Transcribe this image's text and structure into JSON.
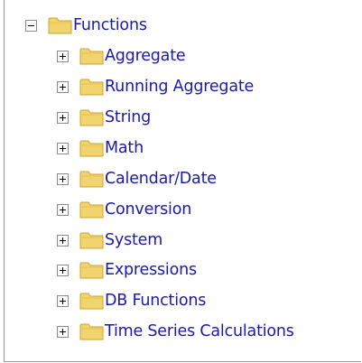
{
  "tree": {
    "root": {
      "label": "Functions",
      "expanded": true,
      "toggle_icon": "minus-box-icon",
      "icon": "folder-icon"
    },
    "children": [
      {
        "label": "Aggregate",
        "expanded": false,
        "toggle_icon": "plus-box-icon",
        "icon": "folder-icon"
      },
      {
        "label": "Running Aggregate",
        "expanded": false,
        "toggle_icon": "plus-box-icon",
        "icon": "folder-icon"
      },
      {
        "label": "String",
        "expanded": false,
        "toggle_icon": "plus-box-icon",
        "icon": "folder-icon"
      },
      {
        "label": "Math",
        "expanded": false,
        "toggle_icon": "plus-box-icon",
        "icon": "folder-icon"
      },
      {
        "label": "Calendar/Date",
        "expanded": false,
        "toggle_icon": "plus-box-icon",
        "icon": "folder-icon"
      },
      {
        "label": "Conversion",
        "expanded": false,
        "toggle_icon": "plus-box-icon",
        "icon": "folder-icon"
      },
      {
        "label": "System",
        "expanded": false,
        "toggle_icon": "plus-box-icon",
        "icon": "folder-icon"
      },
      {
        "label": "Expressions",
        "expanded": false,
        "toggle_icon": "plus-box-icon",
        "icon": "folder-icon"
      },
      {
        "label": "DB Functions",
        "expanded": false,
        "toggle_icon": "plus-box-icon",
        "icon": "folder-icon"
      },
      {
        "label": "Time Series Calculations",
        "expanded": false,
        "toggle_icon": "plus-box-icon",
        "icon": "folder-icon"
      }
    ]
  },
  "colors": {
    "label_text": "#1a1aa8",
    "folder_fill": "#f2d46e",
    "folder_edge": "#c9a233",
    "panel_border": "#9a9a9a"
  }
}
